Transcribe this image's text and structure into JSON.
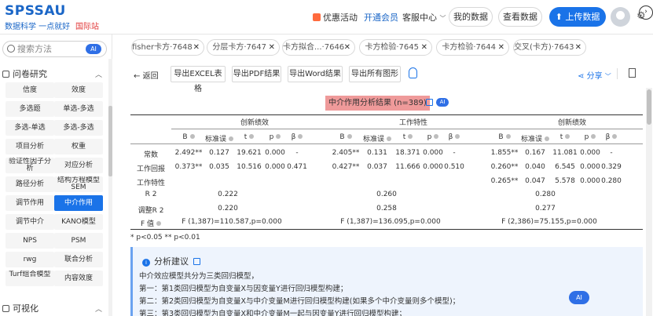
{
  "brand": {
    "name": "SPSSAU",
    "tagline": "数据科学 一点就好",
    "intl": "国际站"
  },
  "nav": {
    "promo": "优惠活动",
    "vip": "开通会员",
    "service": "客服中心",
    "my_data": "我的数据",
    "view_data": "查看数据",
    "upload": "上传数据"
  },
  "sidebar": {
    "search_placeholder": "搜索方法",
    "ai_badge": "AI",
    "section1": "问卷研究",
    "section2": "可视化",
    "tools": [
      "信度",
      "效度",
      "多选题",
      "单选-多选",
      "多选-单选",
      "多选-多选",
      "项目分析",
      "权重",
      "验证性因子分析",
      "对应分析",
      "路径分析",
      "结构方程模型SEM",
      "调节作用",
      "中介作用",
      "调节中介",
      "KANO模型",
      "NPS",
      "PSM",
      "rwg",
      "联合分析",
      "Turf组合模型",
      "内容效度"
    ],
    "active_tool": "中介作用"
  },
  "tabs": [
    "fisher卡方·7648",
    "分层卡方·7647",
    "卡方拟合...·7646",
    "卡方检验·7645",
    "卡方检验·7644",
    "交叉(卡方)·7643"
  ],
  "toolbar": {
    "back": "返回",
    "excel": "导出EXCEL表格",
    "pdf": "导出PDF结果",
    "word": "导出Word结果",
    "figures": "导出所有图形",
    "share": "分享"
  },
  "table": {
    "title": "中介作用分析结果 (n=389)",
    "ai": "AI",
    "groups": [
      "创新绩效",
      "工作特性",
      "创新绩效"
    ],
    "col_headers": [
      "B",
      "标准误",
      "t",
      "p",
      "β",
      "B",
      "标准误",
      "t",
      "p",
      "β",
      "B",
      "标准误",
      "t",
      "p",
      "β"
    ],
    "rows": [
      {
        "label": "常数",
        "cells": [
          "2.492**",
          "0.127",
          "19.621",
          "0.000",
          "-",
          "2.405**",
          "0.131",
          "18.371",
          "0.000",
          "-",
          "1.855**",
          "0.167",
          "11.081",
          "0.000",
          "-"
        ]
      },
      {
        "label": "工作回报",
        "cells": [
          "0.373**",
          "0.035",
          "10.516",
          "0.000",
          "0.471",
          "0.427**",
          "0.037",
          "11.666",
          "0.000",
          "0.510",
          "0.260**",
          "0.040",
          "6.545",
          "0.000",
          "0.329"
        ]
      },
      {
        "label": "工作特性",
        "cells": [
          "",
          "",
          "",
          "",
          "",
          "",
          "",
          "",
          "",
          "",
          "0.265**",
          "0.047",
          "5.578",
          "0.000",
          "0.280"
        ]
      }
    ],
    "r2_label": "R 2",
    "r2": [
      "0.222",
      "0.260",
      "0.280"
    ],
    "adj_r2_label": "调整R 2",
    "adj_r2": [
      "0.220",
      "0.258",
      "0.277"
    ],
    "f_label": "F 值",
    "f": [
      "F (1,387)=110.587,p=0.000",
      "F (1,387)=136.095,p=0.000",
      "F (2,386)=75.155,p=0.000"
    ],
    "note": "* p<0.05 ** p<0.01"
  },
  "advice": {
    "title": "分析建议",
    "lines": [
      "中介效应模型共分为三类回归模型，",
      "第一：第1类回归模型为自变量X与因变量Y进行回归模型构建；",
      "第二：第2类回归模型为自变量X与中介变量M进行回归模型构建(如果多个中介变量则多个模型)；",
      "第三：第3类回归模型为自变量X和中介变量M一起与因变量Y进行回归模型构建；"
    ],
    "ai_button": "AI"
  }
}
